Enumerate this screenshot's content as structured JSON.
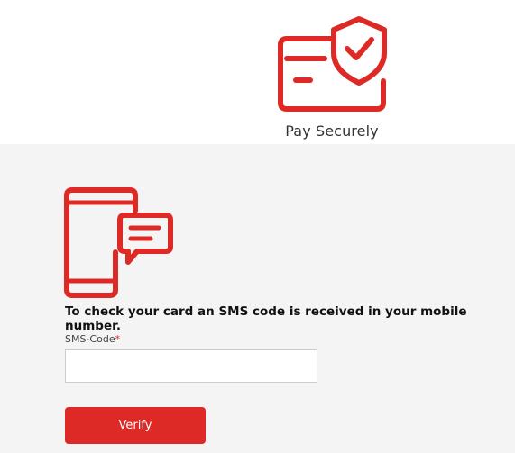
{
  "header": {
    "brand_name": "Pay Securely",
    "logo_icon": "card-shield-check-icon"
  },
  "colors": {
    "accent": "#dd2a26",
    "content_background": "#f4f4f4",
    "header_background": "#ffffff"
  },
  "main": {
    "illustration_icon": "mobile-sms-icon",
    "instruction": "To check your card an SMS code is received in your mobile number.",
    "sms_field": {
      "label": "SMS-Code",
      "required_mark": "*",
      "value": ""
    },
    "verify_label": "Verify"
  }
}
